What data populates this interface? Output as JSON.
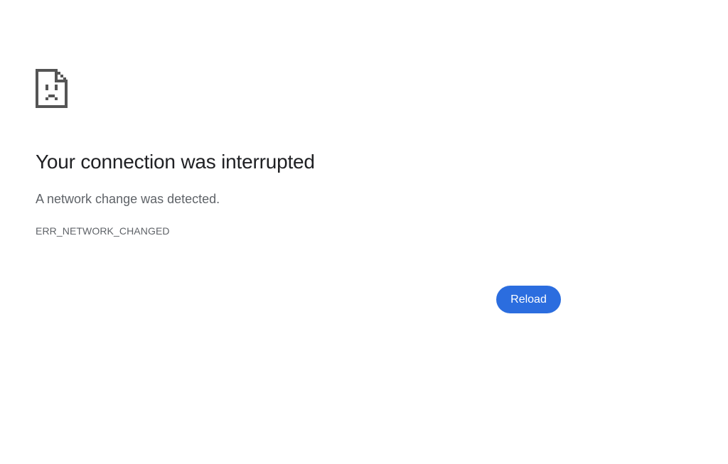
{
  "page": {
    "icon": "sad-page-icon",
    "heading": "Your connection was interrupted",
    "summary": "A network change was detected.",
    "error_code": "ERR_NETWORK_CHANGED"
  },
  "actions": {
    "reload_label": "Reload"
  },
  "colors": {
    "background": "#ffffff",
    "heading": "#202124",
    "secondary_text": "#5f6368",
    "icon": "#555555",
    "button_background": "#2b6ddf",
    "button_text": "#ffffff"
  }
}
